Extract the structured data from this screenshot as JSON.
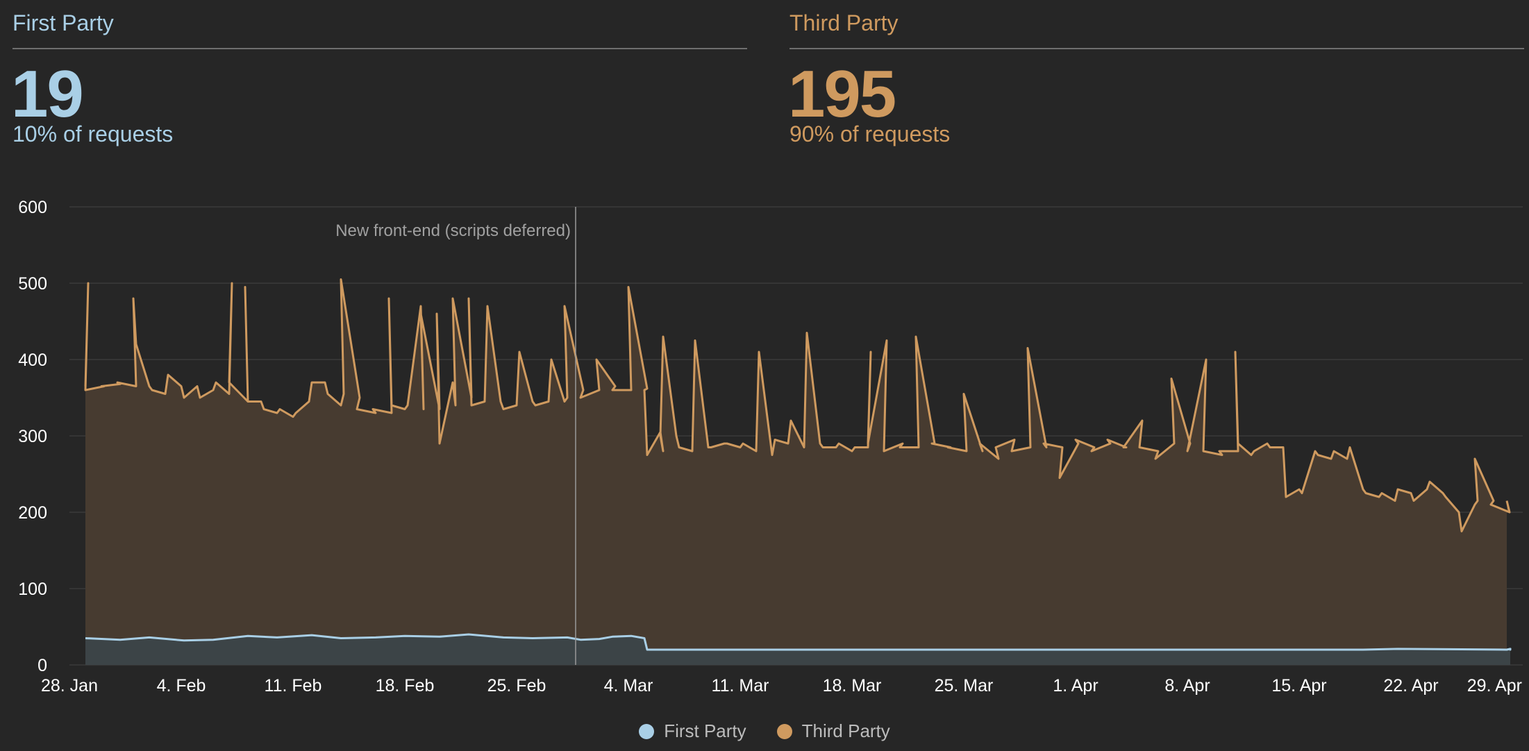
{
  "colors": {
    "background": "#262626",
    "first_party": "#a9cfe6",
    "third_party": "#cf9a5f",
    "first_party_fill": "#3c4447",
    "third_party_fill": "#473b30",
    "grid": "#3a3a3a",
    "axis_text": "#ffffff",
    "annotation": "#a0a0a0"
  },
  "summary": {
    "first_party": {
      "title": "First Party",
      "value": "19",
      "subtitle": "10% of requests"
    },
    "third_party": {
      "title": "Third Party",
      "value": "195",
      "subtitle": "90% of requests"
    }
  },
  "legend": [
    {
      "label": "First Party",
      "color": "#a9cfe6"
    },
    {
      "label": "Third Party",
      "color": "#cf9a5f"
    }
  ],
  "chart_data": {
    "type": "area",
    "title": "",
    "xlabel": "",
    "ylabel": "",
    "ylim": [
      0,
      600
    ],
    "y_ticks": [
      0,
      100,
      200,
      300,
      400,
      500,
      600
    ],
    "x_range": [
      "2019-01-28",
      "2019-04-29"
    ],
    "x_tick_labels": [
      {
        "date": "2019-01-28",
        "label": "28. Jan"
      },
      {
        "date": "2019-02-04",
        "label": "4. Feb"
      },
      {
        "date": "2019-02-11",
        "label": "11. Feb"
      },
      {
        "date": "2019-02-18",
        "label": "18. Feb"
      },
      {
        "date": "2019-02-25",
        "label": "25. Feb"
      },
      {
        "date": "2019-03-04",
        "label": "4. Mar"
      },
      {
        "date": "2019-03-11",
        "label": "11. Mar"
      },
      {
        "date": "2019-03-18",
        "label": "18. Mar"
      },
      {
        "date": "2019-03-25",
        "label": "25. Mar"
      },
      {
        "date": "2019-04-01",
        "label": "1. Apr"
      },
      {
        "date": "2019-04-08",
        "label": "8. Apr"
      },
      {
        "date": "2019-04-15",
        "label": "15. Apr"
      },
      {
        "date": "2019-04-22",
        "label": "22. Apr"
      },
      {
        "date": "2019-04-29",
        "label": "29. Apr"
      }
    ],
    "grid": true,
    "legend_position": "bottom-center",
    "annotations": [
      {
        "date": "2019-02-28",
        "label": "New front-end (scripts deferred)"
      }
    ],
    "series": [
      {
        "name": "Third Party",
        "points": [
          [
            "2019-01-29",
            365
          ],
          [
            "2019-01-29",
            500
          ],
          [
            "2019-01-29",
            360
          ],
          [
            "2019-01-30",
            365
          ],
          [
            "2019-01-30",
            365
          ],
          [
            "2019-01-31",
            368
          ],
          [
            "2019-01-31",
            370
          ],
          [
            "2019-02-01",
            365
          ],
          [
            "2019-02-01",
            480
          ],
          [
            "2019-02-01",
            420
          ],
          [
            "2019-02-02",
            365
          ],
          [
            "2019-02-02",
            360
          ],
          [
            "2019-02-03",
            355
          ],
          [
            "2019-02-03",
            380
          ],
          [
            "2019-02-04",
            365
          ],
          [
            "2019-02-04",
            350
          ],
          [
            "2019-02-05",
            365
          ],
          [
            "2019-02-05",
            350
          ],
          [
            "2019-02-06",
            360
          ],
          [
            "2019-02-06",
            370
          ],
          [
            "2019-02-07",
            355
          ],
          [
            "2019-02-07",
            500
          ],
          [
            "2019-02-07",
            370
          ],
          [
            "2019-02-08",
            345
          ],
          [
            "2019-02-08",
            495
          ],
          [
            "2019-02-08",
            345
          ],
          [
            "2019-02-09",
            345
          ],
          [
            "2019-02-09",
            335
          ],
          [
            "2019-02-10",
            330
          ],
          [
            "2019-02-10",
            335
          ],
          [
            "2019-02-11",
            325
          ],
          [
            "2019-02-11",
            330
          ],
          [
            "2019-02-12",
            345
          ],
          [
            "2019-02-12",
            370
          ],
          [
            "2019-02-13",
            370
          ],
          [
            "2019-02-13",
            355
          ],
          [
            "2019-02-14",
            340
          ],
          [
            "2019-02-14",
            355
          ],
          [
            "2019-02-14",
            505
          ],
          [
            "2019-02-15",
            350
          ],
          [
            "2019-02-15",
            335
          ],
          [
            "2019-02-16",
            330
          ],
          [
            "2019-02-16",
            335
          ],
          [
            "2019-02-17",
            330
          ],
          [
            "2019-02-17",
            480
          ],
          [
            "2019-02-17",
            340
          ],
          [
            "2019-02-18",
            335
          ],
          [
            "2019-02-18",
            340
          ],
          [
            "2019-02-19",
            470
          ],
          [
            "2019-02-19",
            335
          ],
          [
            "2019-02-19",
            460
          ],
          [
            "2019-02-20",
            335
          ],
          [
            "2019-02-20",
            460
          ],
          [
            "2019-02-20",
            290
          ],
          [
            "2019-02-21",
            370
          ],
          [
            "2019-02-21",
            340
          ],
          [
            "2019-02-21",
            480
          ],
          [
            "2019-02-22",
            350
          ],
          [
            "2019-02-22",
            480
          ],
          [
            "2019-02-22",
            340
          ],
          [
            "2019-02-23",
            345
          ],
          [
            "2019-02-23",
            470
          ],
          [
            "2019-02-24",
            345
          ],
          [
            "2019-02-24",
            335
          ],
          [
            "2019-02-25",
            340
          ],
          [
            "2019-02-25",
            410
          ],
          [
            "2019-02-26",
            345
          ],
          [
            "2019-02-26",
            340
          ],
          [
            "2019-02-27",
            345
          ],
          [
            "2019-02-27",
            400
          ],
          [
            "2019-02-28",
            345
          ],
          [
            "2019-02-28",
            350
          ],
          [
            "2019-02-28",
            470
          ],
          [
            "2019-03-01",
            360
          ],
          [
            "2019-03-01",
            350
          ],
          [
            "2019-03-02",
            360
          ],
          [
            "2019-03-02",
            400
          ],
          [
            "2019-03-03",
            365
          ],
          [
            "2019-03-03",
            360
          ],
          [
            "2019-03-04",
            360
          ],
          [
            "2019-03-04",
            495
          ],
          [
            "2019-03-05",
            362
          ],
          [
            "2019-03-05",
            360
          ],
          [
            "2019-03-05",
            275
          ],
          [
            "2019-03-06",
            305
          ],
          [
            "2019-03-06",
            280
          ],
          [
            "2019-03-06",
            300
          ],
          [
            "2019-03-06",
            430
          ],
          [
            "2019-03-07",
            300
          ],
          [
            "2019-03-07",
            285
          ],
          [
            "2019-03-08",
            280
          ],
          [
            "2019-03-08",
            425
          ],
          [
            "2019-03-09",
            285
          ],
          [
            "2019-03-09",
            285
          ],
          [
            "2019-03-10",
            290
          ],
          [
            "2019-03-10",
            290
          ],
          [
            "2019-03-11",
            285
          ],
          [
            "2019-03-11",
            290
          ],
          [
            "2019-03-12",
            280
          ],
          [
            "2019-03-12",
            410
          ],
          [
            "2019-03-13",
            275
          ],
          [
            "2019-03-13",
            295
          ],
          [
            "2019-03-14",
            290
          ],
          [
            "2019-03-14",
            320
          ],
          [
            "2019-03-15",
            285
          ],
          [
            "2019-03-15",
            435
          ],
          [
            "2019-03-16",
            290
          ],
          [
            "2019-03-16",
            285
          ],
          [
            "2019-03-17",
            285
          ],
          [
            "2019-03-17",
            290
          ],
          [
            "2019-03-18",
            280
          ],
          [
            "2019-03-18",
            285
          ],
          [
            "2019-03-19",
            285
          ],
          [
            "2019-03-19",
            410
          ],
          [
            "2019-03-19",
            290
          ],
          [
            "2019-03-20",
            425
          ],
          [
            "2019-03-20",
            280
          ],
          [
            "2019-03-21",
            290
          ],
          [
            "2019-03-21",
            285
          ],
          [
            "2019-03-22",
            285
          ],
          [
            "2019-03-22",
            430
          ],
          [
            "2019-03-23",
            290
          ],
          [
            "2019-03-23",
            290
          ],
          [
            "2019-03-24",
            285
          ],
          [
            "2019-03-24",
            285
          ],
          [
            "2019-03-25",
            280
          ],
          [
            "2019-03-25",
            355
          ],
          [
            "2019-03-26",
            280
          ],
          [
            "2019-03-26",
            290
          ],
          [
            "2019-03-27",
            270
          ],
          [
            "2019-03-27",
            285
          ],
          [
            "2019-03-28",
            295
          ],
          [
            "2019-03-28",
            280
          ],
          [
            "2019-03-29",
            285
          ],
          [
            "2019-03-29",
            415
          ],
          [
            "2019-03-30",
            285
          ],
          [
            "2019-03-30",
            290
          ],
          [
            "2019-03-31",
            285
          ],
          [
            "2019-03-31",
            245
          ],
          [
            "2019-04-01",
            290
          ],
          [
            "2019-04-01",
            295
          ],
          [
            "2019-04-02",
            285
          ],
          [
            "2019-04-02",
            280
          ],
          [
            "2019-04-03",
            290
          ],
          [
            "2019-04-03",
            295
          ],
          [
            "2019-04-04",
            285
          ],
          [
            "2019-04-04",
            285
          ],
          [
            "2019-04-05",
            320
          ],
          [
            "2019-04-05",
            285
          ],
          [
            "2019-04-06",
            280
          ],
          [
            "2019-04-06",
            270
          ],
          [
            "2019-04-07",
            290
          ],
          [
            "2019-04-07",
            375
          ],
          [
            "2019-04-08",
            290
          ],
          [
            "2019-04-08",
            280
          ],
          [
            "2019-04-09",
            400
          ],
          [
            "2019-04-09",
            280
          ],
          [
            "2019-04-10",
            275
          ],
          [
            "2019-04-10",
            280
          ],
          [
            "2019-04-11",
            280
          ],
          [
            "2019-04-11",
            410
          ],
          [
            "2019-04-11",
            290
          ],
          [
            "2019-04-12",
            275
          ],
          [
            "2019-04-12",
            280
          ],
          [
            "2019-04-13",
            290
          ],
          [
            "2019-04-13",
            285
          ],
          [
            "2019-04-14",
            285
          ],
          [
            "2019-04-14",
            220
          ],
          [
            "2019-04-15",
            230
          ],
          [
            "2019-04-15",
            225
          ],
          [
            "2019-04-16",
            280
          ],
          [
            "2019-04-16",
            275
          ],
          [
            "2019-04-17",
            270
          ],
          [
            "2019-04-17",
            280
          ],
          [
            "2019-04-18",
            270
          ],
          [
            "2019-04-18",
            285
          ],
          [
            "2019-04-19",
            230
          ],
          [
            "2019-04-19",
            225
          ],
          [
            "2019-04-20",
            220
          ],
          [
            "2019-04-20",
            225
          ],
          [
            "2019-04-21",
            215
          ],
          [
            "2019-04-21",
            230
          ],
          [
            "2019-04-22",
            225
          ],
          [
            "2019-04-22",
            215
          ],
          [
            "2019-04-23",
            230
          ],
          [
            "2019-04-23",
            240
          ],
          [
            "2019-04-24",
            225
          ],
          [
            "2019-04-24",
            220
          ],
          [
            "2019-04-25",
            200
          ],
          [
            "2019-04-25",
            175
          ],
          [
            "2019-04-26",
            210
          ],
          [
            "2019-04-26",
            215
          ],
          [
            "2019-04-26",
            270
          ],
          [
            "2019-04-27",
            215
          ],
          [
            "2019-04-27",
            210
          ],
          [
            "2019-04-28",
            200
          ],
          [
            "2019-04-28",
            215
          ]
        ]
      },
      {
        "name": "First Party",
        "points": [
          [
            "2019-01-29",
            35
          ],
          [
            "2019-01-31",
            33
          ],
          [
            "2019-02-02",
            36
          ],
          [
            "2019-02-04",
            32
          ],
          [
            "2019-02-06",
            33
          ],
          [
            "2019-02-08",
            38
          ],
          [
            "2019-02-10",
            36
          ],
          [
            "2019-02-12",
            39
          ],
          [
            "2019-02-14",
            35
          ],
          [
            "2019-02-16",
            36
          ],
          [
            "2019-02-18",
            38
          ],
          [
            "2019-02-20",
            37
          ],
          [
            "2019-02-22",
            40
          ],
          [
            "2019-02-24",
            36
          ],
          [
            "2019-02-26",
            35
          ],
          [
            "2019-02-28",
            36
          ],
          [
            "2019-03-01",
            33
          ],
          [
            "2019-03-02",
            34
          ],
          [
            "2019-03-03",
            37
          ],
          [
            "2019-03-04",
            38
          ],
          [
            "2019-03-05",
            35
          ],
          [
            "2019-03-05",
            20
          ],
          [
            "2019-03-12",
            20
          ],
          [
            "2019-03-20",
            20
          ],
          [
            "2019-03-30",
            20
          ],
          [
            "2019-04-10",
            20
          ],
          [
            "2019-04-19",
            20
          ],
          [
            "2019-04-21",
            21
          ],
          [
            "2019-04-28",
            20
          ],
          [
            "2019-05-04",
            21
          ],
          [
            "2019-05-08",
            21
          ],
          [
            "2019-05-14",
            20
          ],
          [
            "2019-05-17",
            20
          ],
          [
            "2019-05-20",
            22
          ],
          [
            "2019-05-23",
            22
          ]
        ]
      }
    ]
  }
}
